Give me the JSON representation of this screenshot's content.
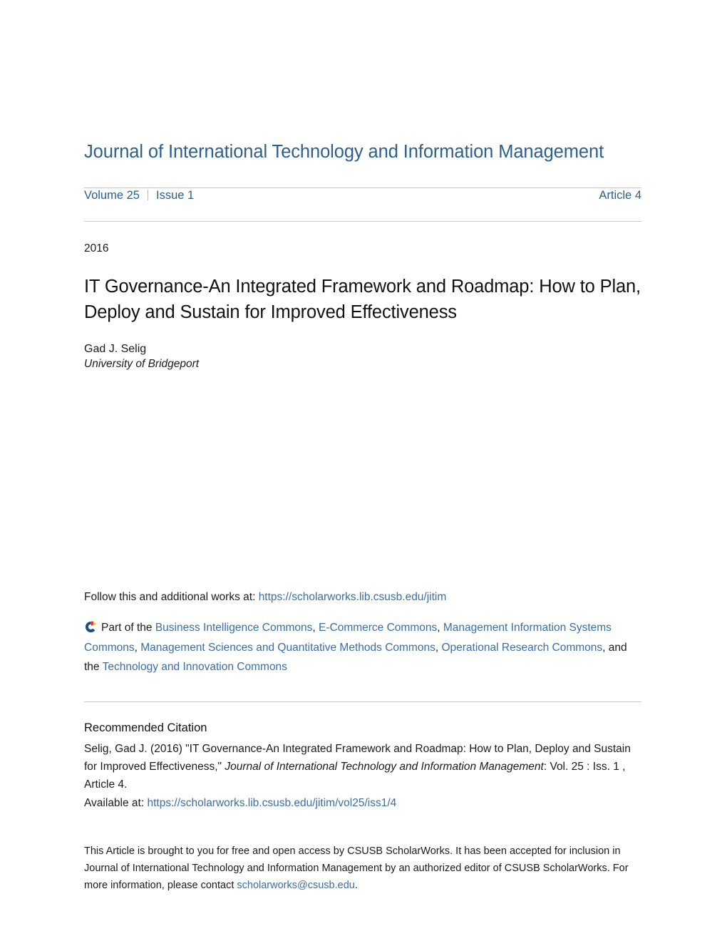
{
  "header": {
    "journal_title": "Journal of International Technology and Information Management",
    "volume": "Volume 25",
    "issue": "Issue 1",
    "article": "Article 4"
  },
  "article": {
    "year": "2016",
    "title": "IT Governance-An Integrated Framework and Roadmap: How to Plan, Deploy and Sustain for Improved Effectiveness",
    "author": "Gad J. Selig",
    "affiliation": "University of Bridgeport"
  },
  "follow": {
    "prefix": "Follow this and additional works at:",
    "url": "https://scholarworks.lib.csusb.edu/jitim",
    "part_of_label": "Part of the",
    "icon": "digital-commons-icon",
    "commons": [
      "Business Intelligence Commons",
      "E-Commerce Commons",
      "Management Information Systems Commons",
      "Management Sciences and Quantitative Methods Commons",
      "Operational Research Commons",
      "Technology and Innovation Commons"
    ],
    "separator": ", ",
    "final_conjunction": ", and the "
  },
  "citation": {
    "heading": "Recommended Citation",
    "text_before_journal": "Selig, Gad J. (2016) \"IT Governance-An Integrated Framework and Roadmap: How to Plan, Deploy and Sustain for Improved Effectiveness,\" ",
    "journal_name": "Journal of International Technology and Information Management",
    "text_after_journal": ": Vol. 25 : Iss. 1 , Article 4.",
    "available_label": "Available at:",
    "available_url": "https://scholarworks.lib.csusb.edu/jitim/vol25/iss1/4"
  },
  "footer": {
    "text_before_email": "This Article is brought to you for free and open access by CSUSB ScholarWorks. It has been accepted for inclusion in Journal of International Technology and Information Management by an authorized editor of CSUSB ScholarWorks. For more information, please contact ",
    "email": "scholarworks@csusb.edu",
    "text_after_email": "."
  },
  "colors": {
    "heading_blue": "#2c5f8a",
    "link_blue": "#3a6ea5",
    "rule_gray": "#c9c9c9",
    "icon_blue": "#1a4f8a",
    "icon_red": "#d93a2b",
    "icon_yellow": "#f2c11a"
  }
}
